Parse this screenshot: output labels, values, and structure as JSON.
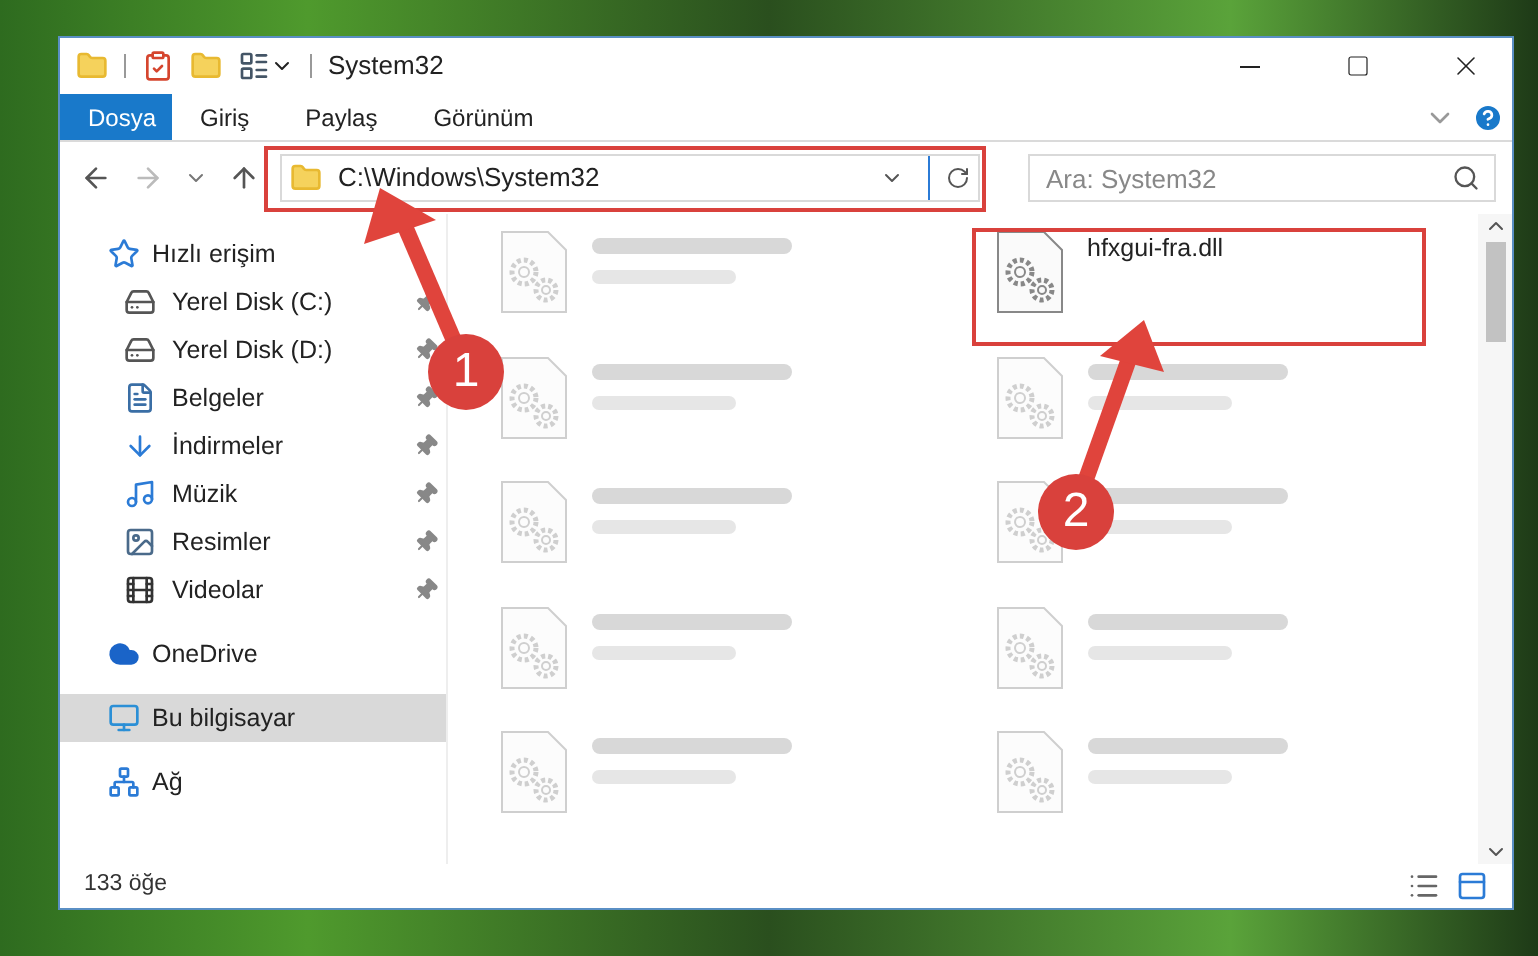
{
  "window": {
    "title": "System32"
  },
  "ribbon_tabs": [
    {
      "label": "Dosya",
      "selected": true
    },
    {
      "label": "Giriş",
      "selected": false
    },
    {
      "label": "Paylaş",
      "selected": false
    },
    {
      "label": "Görünüm",
      "selected": false
    }
  ],
  "address_bar": {
    "path": "C:\\Windows\\System32"
  },
  "search": {
    "placeholder": "Ara: System32"
  },
  "sidebar": {
    "items": [
      {
        "label": "Hızlı erişim",
        "kind": "star",
        "selected": false,
        "children": [
          {
            "label": "Yerel Disk (C:)",
            "kind": "drive",
            "pinned": true
          },
          {
            "label": "Yerel Disk (D:)",
            "kind": "drive",
            "pinned": true
          },
          {
            "label": "Belgeler",
            "kind": "document",
            "pinned": true
          },
          {
            "label": "İndirmeler",
            "kind": "download",
            "pinned": true
          },
          {
            "label": "Müzik",
            "kind": "music",
            "pinned": true
          },
          {
            "label": "Resimler",
            "kind": "picture",
            "pinned": true
          },
          {
            "label": "Videolar",
            "kind": "video",
            "pinned": true
          }
        ]
      },
      {
        "label": "OneDrive",
        "kind": "cloud",
        "selected": false
      },
      {
        "label": "Bu bilgisayar",
        "kind": "computer",
        "selected": true
      },
      {
        "label": "Ağ",
        "kind": "network",
        "selected": false
      }
    ]
  },
  "files": [
    {
      "blurred": true
    },
    {
      "name": "hfxgui-fra.dll",
      "blurred": false
    },
    {
      "blurred": true
    },
    {
      "blurred": true
    },
    {
      "blurred": true
    },
    {
      "blurred": true
    },
    {
      "blurred": true
    },
    {
      "blurred": true
    },
    {
      "blurred": true
    },
    {
      "blurred": true
    }
  ],
  "status_bar": {
    "item_count": "133 öğe"
  },
  "annotations": [
    "1",
    "2"
  ]
}
